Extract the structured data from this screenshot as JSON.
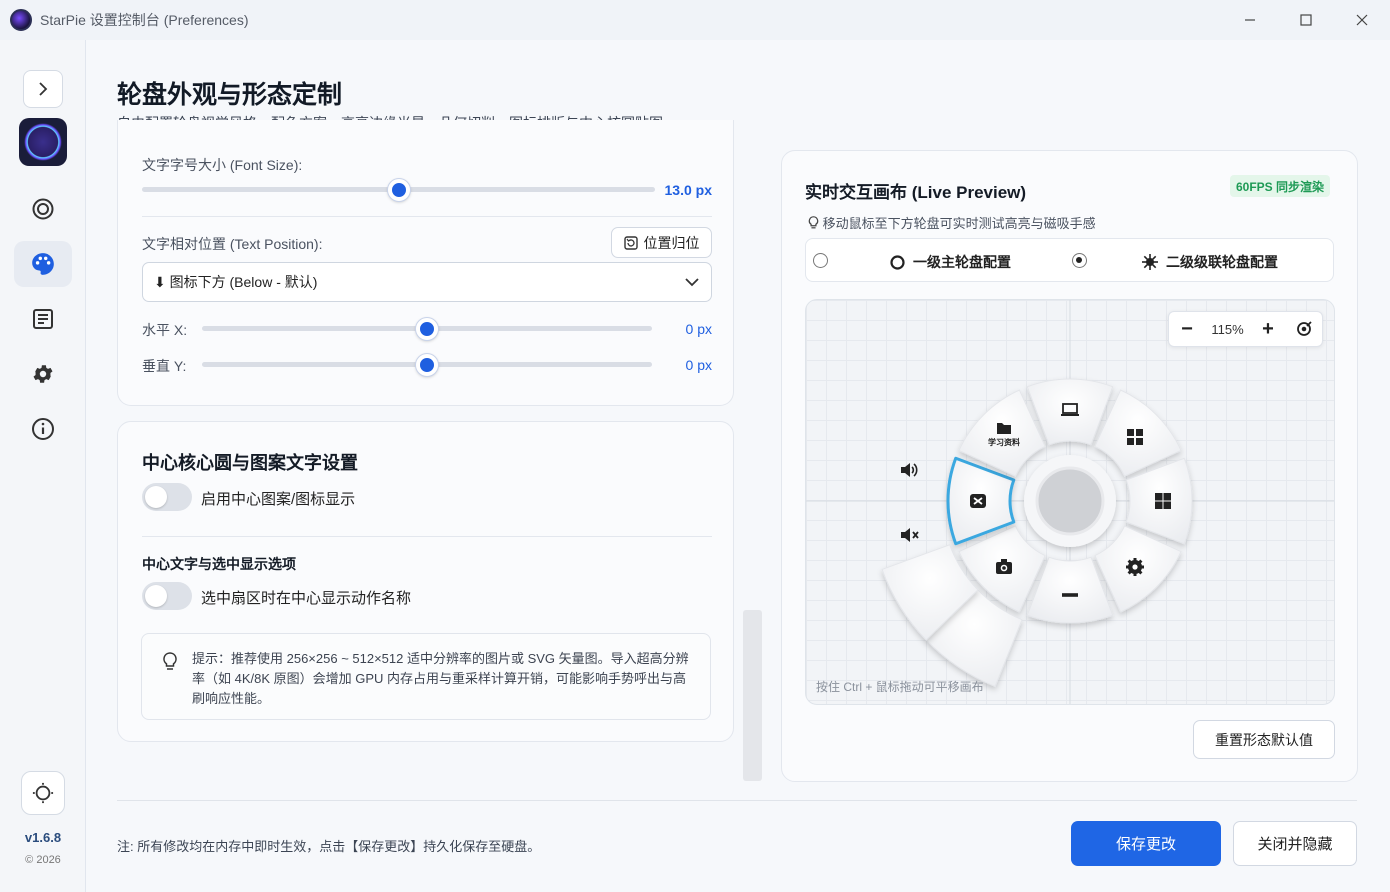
{
  "window": {
    "title": "StarPie 设置控制台 (Preferences)",
    "minimize_icon": "minimize-icon",
    "maximize_icon": "maximize-icon",
    "close_icon": "close-icon"
  },
  "sidebar": {
    "version": "v1.6.8",
    "copyright": "© 2026",
    "items": [
      {
        "name": "sidebar-item-wheel",
        "icon": "ring-icon",
        "active": false
      },
      {
        "name": "sidebar-item-appearance",
        "icon": "palette-icon",
        "active": true
      },
      {
        "name": "sidebar-item-actions",
        "icon": "document-list-icon",
        "active": false
      },
      {
        "name": "sidebar-item-settings",
        "icon": "gear-icon",
        "active": false
      },
      {
        "name": "sidebar-item-about",
        "icon": "info-icon",
        "active": false
      }
    ]
  },
  "header": {
    "title": "轮盘外观与形态定制",
    "subtitle": "自由配置轮盘视觉风格、配色方案、高亮边缘光晕、几何切削、图标排版与中心核圆贴图。"
  },
  "text_settings": {
    "font_size_label": "文字字号大小 (Font Size):",
    "font_size_value": "13.0 px",
    "font_size_fraction": 0.5,
    "position_label": "文字相对位置 (Text Position):",
    "reset_position_button": "位置归位",
    "position_select_value": "⬇ 图标下方 (Below - 默认)",
    "offset_x_label": "水平 X:",
    "offset_x_value": "0 px",
    "offset_y_label": "垂直 Y:",
    "offset_y_value": "0 px"
  },
  "center_settings": {
    "title": "中心核心圆与图案文字设置",
    "enable_pattern_label": "启用中心图案/图标显示",
    "enable_pattern_on": false,
    "center_text_heading": "中心文字与选中显示选项",
    "show_action_name_label": "选中扇区时在中心显示动作名称",
    "show_action_name_on": false,
    "tip_text": "提示：推荐使用 256×256 ~ 512×512 适中分辨率的图片或 SVG 矢量图。导入超高分辨率（如 4K/8K 原图）会增加 GPU 内存占用与重采样计算开销，可能影响手势呼出与高刷响应性能。"
  },
  "preview": {
    "title": "实时交互画布 (Live Preview)",
    "badge": "60FPS 同步渲染",
    "hint": "移动鼠标至下方轮盘可实时测试高亮与磁吸手感",
    "radio_primary": "一级主轮盘配置",
    "radio_secondary": "二级级联轮盘配置",
    "selected_radio": "secondary",
    "zoom": "115%",
    "canvas_footer": "按住 Ctrl + 鼠标拖动可平移画布",
    "reset_button": "重置形态默认值",
    "wheel_folder_label": "学习资料",
    "colors": {
      "accent": "#1f66e5",
      "highlight": "#3aa8e0",
      "badge_green": "#1e9a55"
    }
  },
  "footer": {
    "note": "注: 所有修改均在内存中即时生效，点击【保存更改】持久化保存至硬盘。",
    "save_button": "保存更改",
    "close_button": "关闭并隐藏"
  }
}
